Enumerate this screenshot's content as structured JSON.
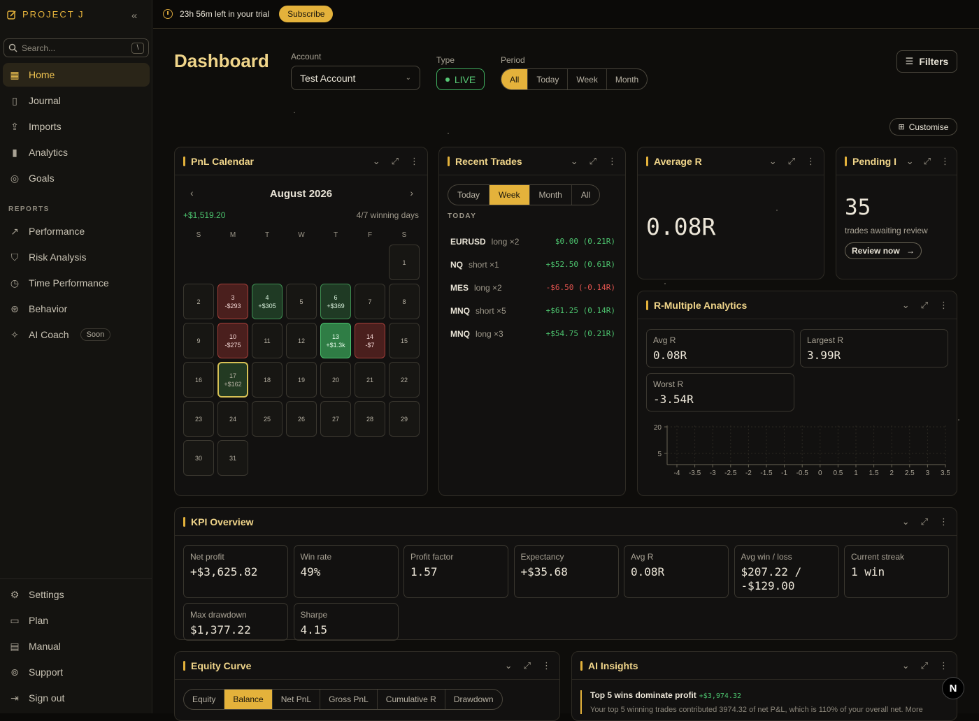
{
  "brand": {
    "name": "PROJECT J"
  },
  "search": {
    "placeholder": "Search...",
    "shortcut": "\\"
  },
  "nav": {
    "main": [
      {
        "label": "Home",
        "icon": "home-grid-icon",
        "active": true
      },
      {
        "label": "Journal",
        "icon": "book-icon"
      },
      {
        "label": "Imports",
        "icon": "upload-icon"
      },
      {
        "label": "Analytics",
        "icon": "bar-chart-icon"
      },
      {
        "label": "Goals",
        "icon": "target-icon"
      }
    ],
    "reports_label": "REPORTS",
    "reports": [
      {
        "label": "Performance",
        "icon": "trend-icon"
      },
      {
        "label": "Risk Analysis",
        "icon": "shield-icon"
      },
      {
        "label": "Time Performance",
        "icon": "clock-icon"
      },
      {
        "label": "Behavior",
        "icon": "brain-icon"
      },
      {
        "label": "AI Coach",
        "icon": "sparkle-icon",
        "badge": "Soon"
      }
    ],
    "bottom": [
      {
        "label": "Settings",
        "icon": "gear-icon"
      },
      {
        "label": "Plan",
        "icon": "card-icon"
      },
      {
        "label": "Manual",
        "icon": "document-icon"
      },
      {
        "label": "Support",
        "icon": "lifebuoy-icon"
      },
      {
        "label": "Sign out",
        "icon": "sign-out-icon"
      }
    ]
  },
  "topbar": {
    "trial_text": "23h 56m left in your trial",
    "subscribe_label": "Subscribe"
  },
  "header": {
    "title": "Dashboard",
    "account_label": "Account",
    "account_value": "Test Account",
    "type_label": "Type",
    "type_value": "LIVE",
    "period_label": "Period",
    "period_options": [
      "All",
      "Today",
      "Week",
      "Month"
    ],
    "period_selected": "All",
    "filters_label": "Filters",
    "customise_label": "Customise"
  },
  "pnl_calendar": {
    "title": "PnL Calendar",
    "month": "August 2026",
    "total": "+$1,519.20",
    "winning_days": "4/7 winning days",
    "weekdays": [
      "S",
      "M",
      "T",
      "W",
      "T",
      "F",
      "S"
    ],
    "start_offset": 6,
    "days": [
      {
        "d": "1"
      },
      {
        "d": "2"
      },
      {
        "d": "3",
        "amt": "-$293",
        "kind": "loss"
      },
      {
        "d": "4",
        "amt": "+$305",
        "kind": "win"
      },
      {
        "d": "5"
      },
      {
        "d": "6",
        "amt": "+$369",
        "kind": "win"
      },
      {
        "d": "7"
      },
      {
        "d": "8"
      },
      {
        "d": "9"
      },
      {
        "d": "10",
        "amt": "-$275",
        "kind": "loss"
      },
      {
        "d": "11"
      },
      {
        "d": "12"
      },
      {
        "d": "13",
        "amt": "+$1.3k",
        "kind": "bigwin"
      },
      {
        "d": "14",
        "amt": "-$7",
        "kind": "loss"
      },
      {
        "d": "15"
      },
      {
        "d": "16"
      },
      {
        "d": "17",
        "amt": "+$162",
        "kind": "today"
      },
      {
        "d": "18"
      },
      {
        "d": "19"
      },
      {
        "d": "20"
      },
      {
        "d": "21"
      },
      {
        "d": "22"
      },
      {
        "d": "23"
      },
      {
        "d": "24"
      },
      {
        "d": "25"
      },
      {
        "d": "26"
      },
      {
        "d": "27"
      },
      {
        "d": "28"
      },
      {
        "d": "29"
      },
      {
        "d": "30"
      },
      {
        "d": "31"
      }
    ]
  },
  "recent_trades": {
    "title": "Recent Trades",
    "tabs": [
      "Today",
      "Week",
      "Month",
      "All"
    ],
    "selected_tab": "Week",
    "group_label": "TODAY",
    "trades": [
      {
        "symbol": "EURUSD",
        "side": "long ×2",
        "pnl": "$0.00 (0.21R)",
        "tone": "green"
      },
      {
        "symbol": "NQ",
        "side": "short ×1",
        "pnl": "+$52.50 (0.61R)",
        "tone": "green"
      },
      {
        "symbol": "MES",
        "side": "long ×2",
        "pnl": "-$6.50 (-0.14R)",
        "tone": "red"
      },
      {
        "symbol": "MNQ",
        "side": "short ×5",
        "pnl": "+$61.25 (0.14R)",
        "tone": "green"
      },
      {
        "symbol": "MNQ",
        "side": "long ×3",
        "pnl": "+$54.75 (0.21R)",
        "tone": "green"
      }
    ]
  },
  "average_r": {
    "title": "Average R",
    "value": "0.08R"
  },
  "pending": {
    "title": "Pending I",
    "count": "35",
    "caption": "trades awaiting review",
    "button": "Review now"
  },
  "r_multiple": {
    "title": "R-Multiple Analytics",
    "avg_label": "Avg R",
    "avg_value": "0.08R",
    "largest_label": "Largest R",
    "largest_value": "3.99R",
    "worst_label": "Worst R",
    "worst_value": "-3.54R"
  },
  "chart_data": {
    "type": "bar",
    "title": "",
    "xlabel": "",
    "ylabel": "",
    "x_ticks": [
      "-4",
      "-3.5",
      "-3",
      "-2.5",
      "-2",
      "-1.5",
      "-1",
      "-0.5",
      "0",
      "0.5",
      "1",
      "1.5",
      "2",
      "2.5",
      "3",
      "3.5"
    ],
    "y_ticks": [
      "20",
      "5"
    ],
    "ylim": [
      0,
      25
    ],
    "grid": true,
    "values": []
  },
  "kpi": {
    "title": "KPI Overview",
    "items": [
      {
        "label": "Net profit",
        "value": "+$3,625.82",
        "tone": "green"
      },
      {
        "label": "Win rate",
        "value": "49%",
        "tone": ""
      },
      {
        "label": "Profit factor",
        "value": "1.57",
        "tone": ""
      },
      {
        "label": "Expectancy",
        "value": "+$35.68",
        "tone": "green"
      },
      {
        "label": "Avg R",
        "value": "0.08R",
        "tone": ""
      },
      {
        "label": "Avg win / loss",
        "value": "$207.22 / -$129.00",
        "tone": ""
      },
      {
        "label": "Current streak",
        "value": "1 win",
        "tone": ""
      },
      {
        "label": "Max drawdown",
        "value": "$1,377.22",
        "tone": "red"
      },
      {
        "label": "Sharpe",
        "value": "4.15",
        "tone": ""
      }
    ]
  },
  "equity": {
    "title": "Equity Curve",
    "tabs": [
      "Equity",
      "Balance",
      "Net PnL",
      "Gross PnL",
      "Cumulative R",
      "Drawdown"
    ],
    "selected_tab": "Balance"
  },
  "ai_insights": {
    "title": "AI Insights",
    "headline": "Top 5 wins dominate profit",
    "amount": "+$3,974.32",
    "detail": "Your top 5 winning trades contributed 3974.32 of net P&L, which is 110% of your overall net. More"
  },
  "colors": {
    "accent": "#e4b23b",
    "positive": "#4cc36e",
    "negative": "#e2544f",
    "background": "#0b0a08"
  }
}
